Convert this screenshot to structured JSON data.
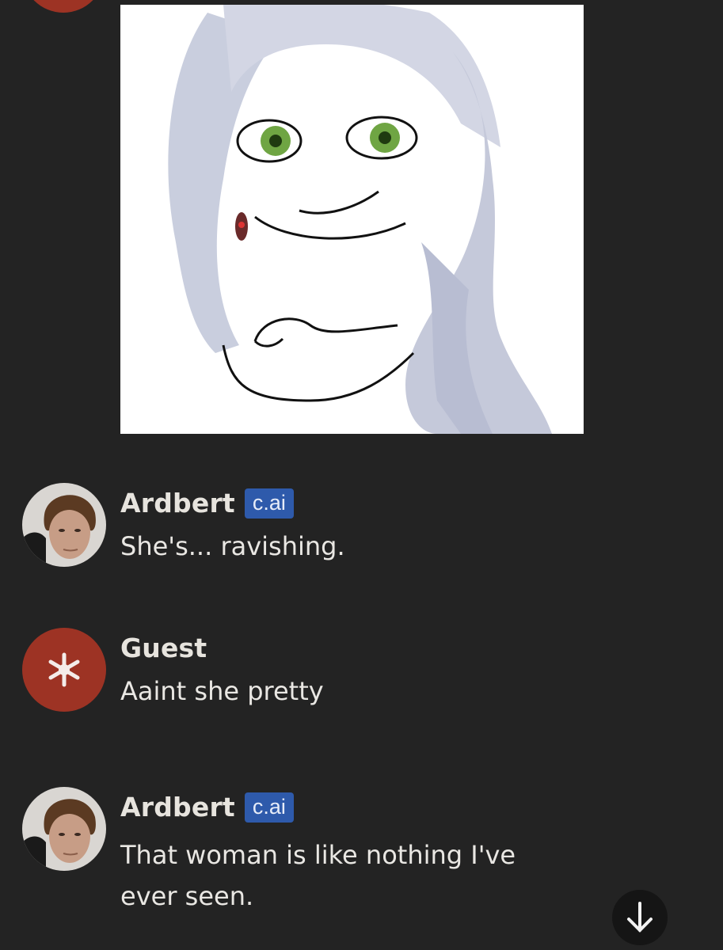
{
  "chat": {
    "messages": [
      {
        "sender": "Ardbert",
        "badge": "c.ai",
        "text": "She's... ravishing.",
        "avatar": "character-portrait"
      },
      {
        "sender": "Guest",
        "text": "Aaint she pretty",
        "avatar": "guest-star-icon"
      },
      {
        "sender": "Ardbert",
        "badge": "c.ai",
        "text": "That woman is like nothing I've ever seen.",
        "avatar": "character-portrait"
      }
    ]
  },
  "icons": {
    "scroll_down": "arrow-down-icon",
    "guest_avatar": "asterisk-star-icon"
  },
  "colors": {
    "background": "#232323",
    "guest_avatar": "#9d3324",
    "badge": "#2e5aab",
    "text": "#e9e7e3"
  }
}
